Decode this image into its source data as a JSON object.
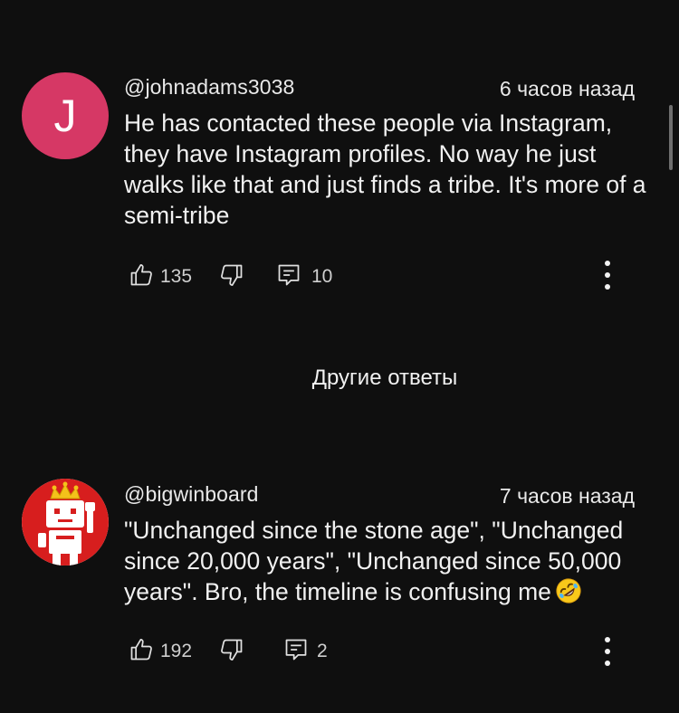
{
  "comments": [
    {
      "author": "@johnadams3038",
      "time": "6 часов назад",
      "avatar_letter": "J",
      "avatar_color": "#d63865",
      "text": "He has contacted these people via Instagram, they have Instagram profiles. No  way he just walks like that and just finds a tribe. It's more of a semi-tribe",
      "likes": "135",
      "replies": "10"
    },
    {
      "author": "@bigwinboard",
      "time": "7 часов назад",
      "avatar_icon": "robot-king-avatar",
      "text": "\"Unchanged since the stone age\", \"Unchanged since 20,000 years\", \"Unchanged since 50,000 years\". Bro, the timeline is confusing me",
      "emoji": "rolling-on-floor-laughing-emoji",
      "likes": "192",
      "replies": "2"
    }
  ],
  "other_replies_label": "Другие ответы",
  "icons": {
    "like": "thumbs-up-icon",
    "dislike": "thumbs-down-icon",
    "reply": "reply-icon",
    "more": "more-vertical-icon"
  },
  "colors": {
    "background": "#0f0f0f",
    "text": "#f1f1f1",
    "avatar_robot_bg": "#d71e1e",
    "crown": "#f4c21a"
  }
}
